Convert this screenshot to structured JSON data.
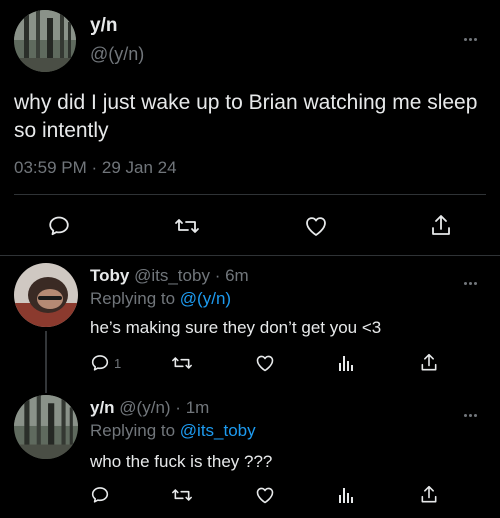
{
  "main_tweet": {
    "display_name": "y/n",
    "handle": "@(y/n)",
    "text": "why did I just wake up to Brian watching me sleep so intently",
    "time": "03:59 PM",
    "date_sep": "·",
    "date": "29 Jan 24"
  },
  "replies": [
    {
      "display_name": "Toby",
      "handle": "@its_toby",
      "sep": "·",
      "age": "6m",
      "replying_prefix": "Replying to",
      "replying_to": "@(y/n)",
      "text": "he’s making sure they don’t get you <3",
      "reply_count": "1"
    },
    {
      "display_name": "y/n",
      "handle": "@(y/n)",
      "sep": "·",
      "age": "1m",
      "replying_prefix": "Replying to",
      "replying_to": "@its_toby",
      "text": "who the fuck is they ???",
      "reply_count": ""
    }
  ],
  "icons": {
    "reply": "speech-bubble-icon",
    "retweet": "retweet-arrows-icon",
    "like": "heart-icon",
    "views": "bar-chart-icon",
    "share": "share-upload-icon",
    "more": "more-dots-icon"
  },
  "colors": {
    "background": "#000000",
    "text": "#e7e9ea",
    "muted": "#71767b",
    "accent": "#1d9bf0",
    "divider": "#2f3336"
  }
}
